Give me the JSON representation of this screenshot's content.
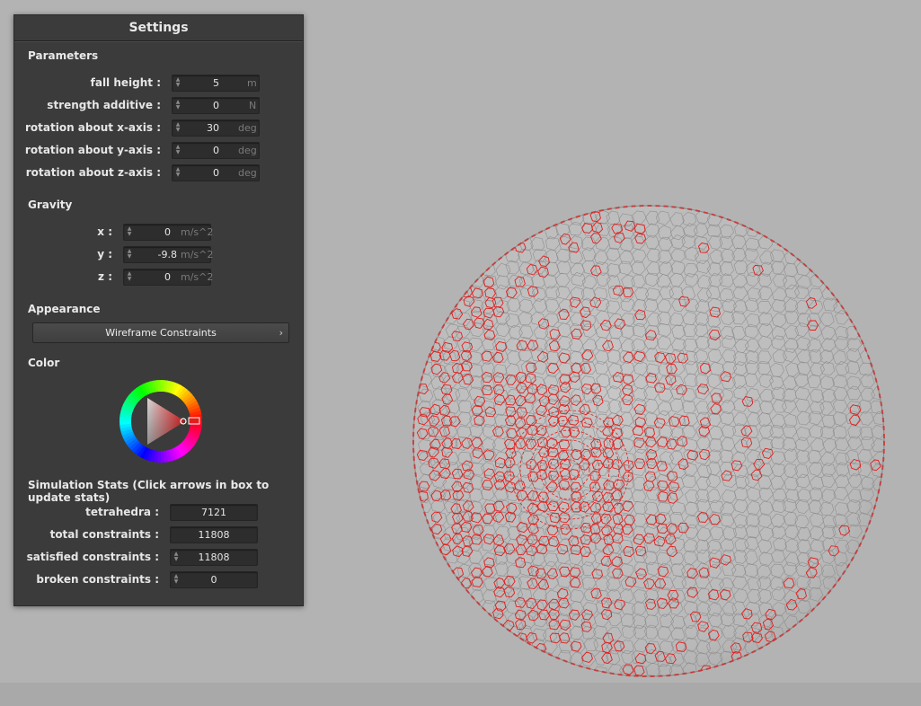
{
  "panel": {
    "title": "Settings",
    "parameters": {
      "heading": "Parameters",
      "rows": [
        {
          "label": "fall height :",
          "value": "5",
          "unit": "m"
        },
        {
          "label": "strength additive :",
          "value": "0",
          "unit": "N"
        },
        {
          "label": "rotation about x-axis :",
          "value": "30",
          "unit": "deg"
        },
        {
          "label": "rotation about y-axis :",
          "value": "0",
          "unit": "deg"
        },
        {
          "label": "rotation about z-axis :",
          "value": "0",
          "unit": "deg"
        }
      ]
    },
    "gravity": {
      "heading": "Gravity",
      "rows": [
        {
          "label": "x :",
          "value": "0",
          "unit": "m/s^2"
        },
        {
          "label": "y :",
          "value": "-9.8",
          "unit": "m/s^2"
        },
        {
          "label": "z :",
          "value": "0",
          "unit": "m/s^2"
        }
      ]
    },
    "appearance": {
      "heading": "Appearance",
      "mode": "Wireframe Constraints",
      "chevron": "›"
    },
    "color": {
      "heading": "Color",
      "selected": "#e41d1d"
    },
    "stats": {
      "heading": "Simulation Stats (Click arrows in box to update stats)",
      "rows": [
        {
          "label": "tetrahedra :",
          "value": "7121"
        },
        {
          "label": "total constraints :",
          "value": "11808"
        },
        {
          "label": "satisfied constraints :",
          "value": "11808"
        },
        {
          "label": "broken constraints :",
          "value": "0"
        }
      ]
    }
  },
  "scene": {
    "background": "#b3b3b3",
    "mesh_gray": "#8f8f8f",
    "mesh_red": "#e41d1d"
  }
}
